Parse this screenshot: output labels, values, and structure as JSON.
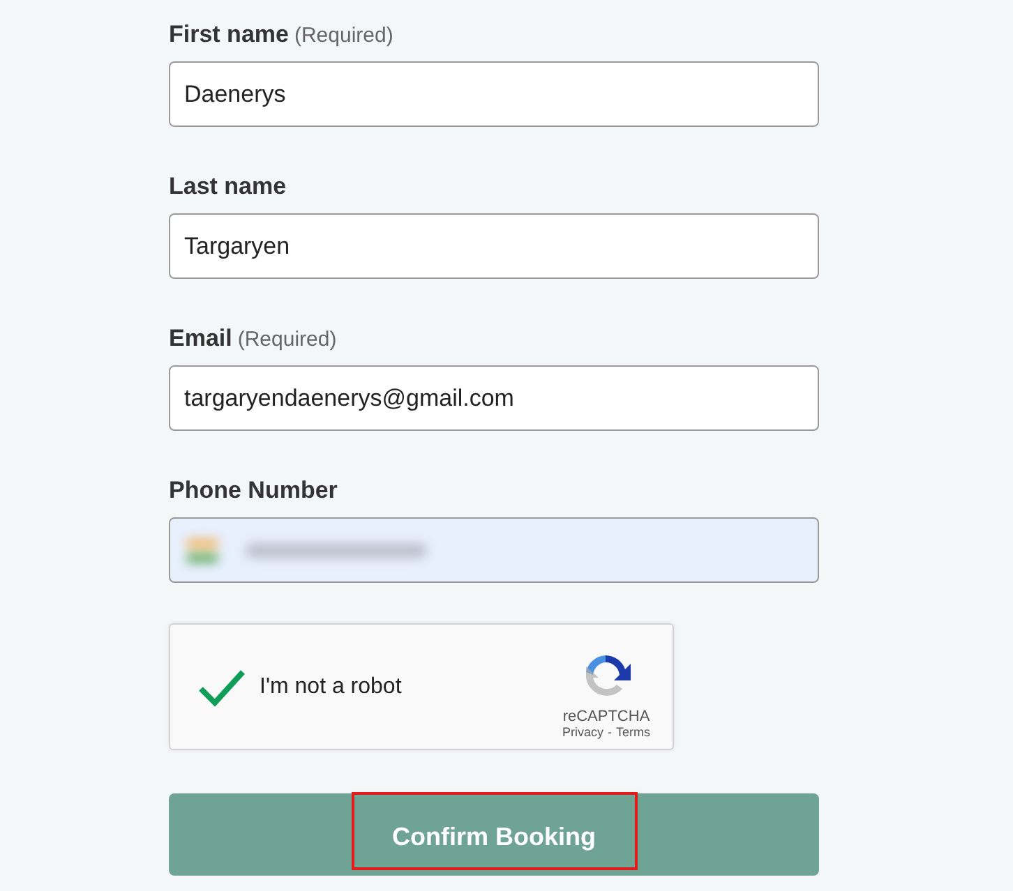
{
  "fields": [
    {
      "kind": "text",
      "label": "First name",
      "note": "(Required)",
      "value": "Daenerys",
      "autofilled": false
    },
    {
      "kind": "text",
      "label": "Last name",
      "value": "Targaryen",
      "autofilled": false
    },
    {
      "kind": "text",
      "label": "Email",
      "note": "(Required)",
      "value": "targaryendaenerys@gmail.com",
      "autofilled": false
    },
    {
      "kind": "phone",
      "label": "Phone Number",
      "autofilled": true
    }
  ],
  "captcha": {
    "label": "I'm not a robot",
    "checked": true,
    "brand": "reCAPTCHA",
    "privacy": "Privacy",
    "separator": "-",
    "terms": "Terms"
  },
  "submit": {
    "label": "Confirm Booking",
    "highlighted": true
  }
}
